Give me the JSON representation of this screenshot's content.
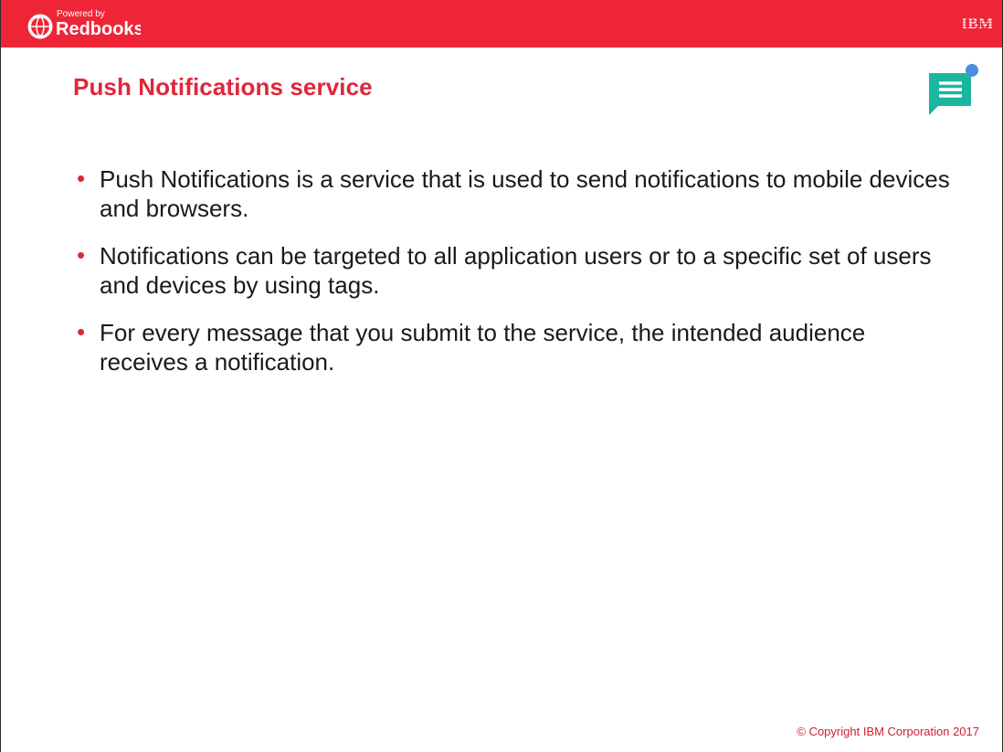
{
  "header": {
    "logo_small_text": "Powered by",
    "logo_main_text": "Redbooks",
    "brand": "IBM",
    "bar_color": "#ee2536"
  },
  "title": "Push Notifications service",
  "icons": {
    "note": "note-comment-icon"
  },
  "bullets": [
    {
      "text": "Push Notifications is a service that is used to send notifications to mobile devices and browsers."
    },
    {
      "text": "Notifications can be targeted to all application users or to a specific set of users and devices by using tags."
    },
    {
      "text": "For every message that you submit to the service, the intended audience receives a notification."
    }
  ],
  "footer": {
    "copyright": "© Copyright IBM Corporation 2017"
  },
  "colors": {
    "accent_red": "#e0263a",
    "note_teal": "#1bb6a0",
    "note_dot": "#4a90e2"
  }
}
